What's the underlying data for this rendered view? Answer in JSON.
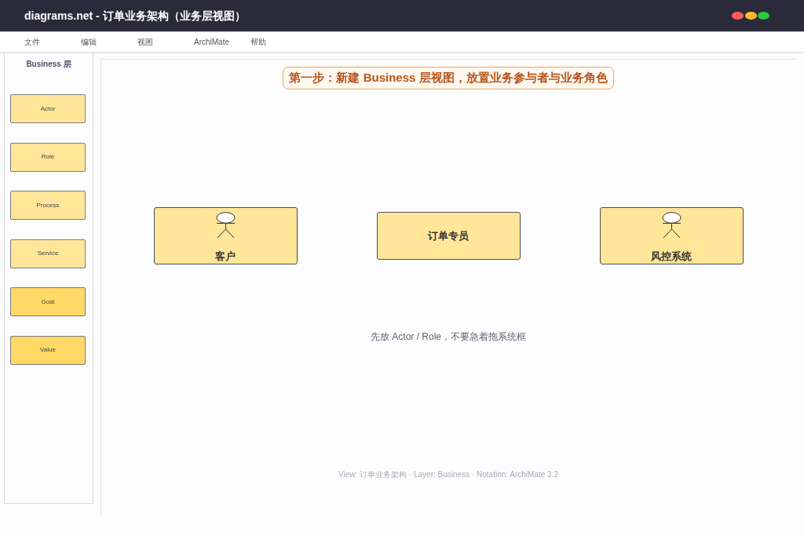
{
  "window": {
    "title": "diagrams.net - 订单业务架构（业务层视图）"
  },
  "menu": [
    "文件",
    "编辑",
    "视图",
    "ArchiMate",
    "帮助"
  ],
  "palette": {
    "title": "Business 层",
    "items": [
      {
        "label": "Actor",
        "color": "#ffe699"
      },
      {
        "label": "Role",
        "color": "#ffe699"
      },
      {
        "label": "Process",
        "color": "#ffe699"
      },
      {
        "label": "Service",
        "color": "#ffe699"
      },
      {
        "label": "Goal",
        "color": "#ffd966"
      },
      {
        "label": "Value",
        "color": "#ffd966"
      }
    ]
  },
  "canvas": {
    "banner": "第一步：新建 Business 层视图，放置业务参与者与业务角色",
    "nodes": [
      {
        "label": "客户",
        "kind": "actor"
      },
      {
        "label": "订单专员",
        "kind": "role"
      },
      {
        "label": "风控系统",
        "kind": "actor"
      }
    ],
    "hint": "先放 Actor / Role，不要急着拖系统框",
    "footer": "View: 订单业务架构 · Layer: Business · Notation: ArchiMate 3.2"
  }
}
